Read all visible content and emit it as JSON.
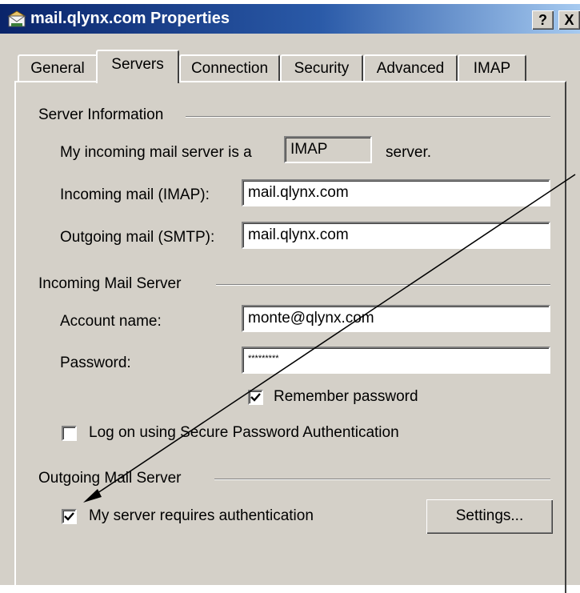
{
  "window": {
    "title": "mail.qlynx.com Properties",
    "help_label": "?",
    "close_label": "X"
  },
  "tabs": [
    {
      "label": "General"
    },
    {
      "label": "Servers",
      "active": true
    },
    {
      "label": "Connection"
    },
    {
      "label": "Security"
    },
    {
      "label": "Advanced"
    },
    {
      "label": "IMAP"
    }
  ],
  "server_info": {
    "group_label": "Server Information",
    "incoming_type_prefix": "My incoming mail server is a",
    "incoming_type_value": "IMAP",
    "incoming_type_suffix": "server.",
    "incoming_label": "Incoming mail (IMAP):",
    "incoming_value": "mail.qlynx.com",
    "outgoing_label": "Outgoing mail (SMTP):",
    "outgoing_value": "mail.qlynx.com"
  },
  "incoming_server": {
    "group_label": "Incoming Mail Server",
    "account_label": "Account name:",
    "account_value": "monte@qlynx.com",
    "password_label": "Password:",
    "password_value": "*********",
    "remember_label": "Remember password",
    "remember_checked": true,
    "spa_label": "Log on using Secure Password Authentication",
    "spa_checked": false
  },
  "outgoing_server": {
    "group_label": "Outgoing Mail Server",
    "auth_label": "My server requires authentication",
    "auth_checked": true,
    "settings_label": "Settings..."
  }
}
